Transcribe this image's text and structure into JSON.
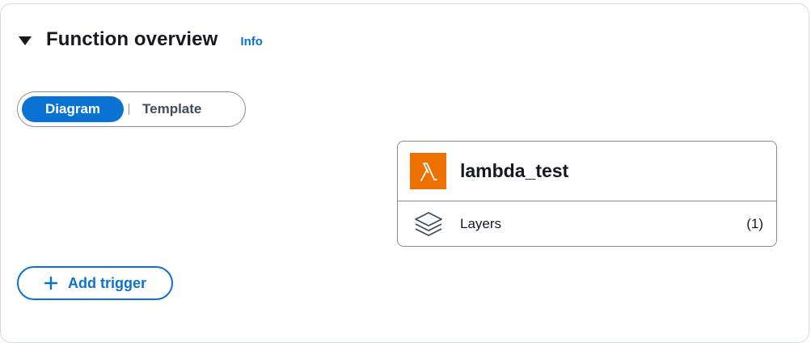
{
  "overview": {
    "title": "Function overview",
    "info_label": "Info"
  },
  "view_toggle": {
    "options": [
      {
        "label": "Diagram",
        "selected": true
      },
      {
        "label": "Template",
        "selected": false
      }
    ]
  },
  "function_card": {
    "name": "lambda_test",
    "icon": "lambda-icon",
    "icon_color": "#ed7100",
    "layers_label": "Layers",
    "layers_count": "(1)"
  },
  "trigger": {
    "add_label": "Add trigger"
  },
  "colors": {
    "accent": "#0972d3",
    "text": "#16191f",
    "border": "#8c8c94"
  }
}
